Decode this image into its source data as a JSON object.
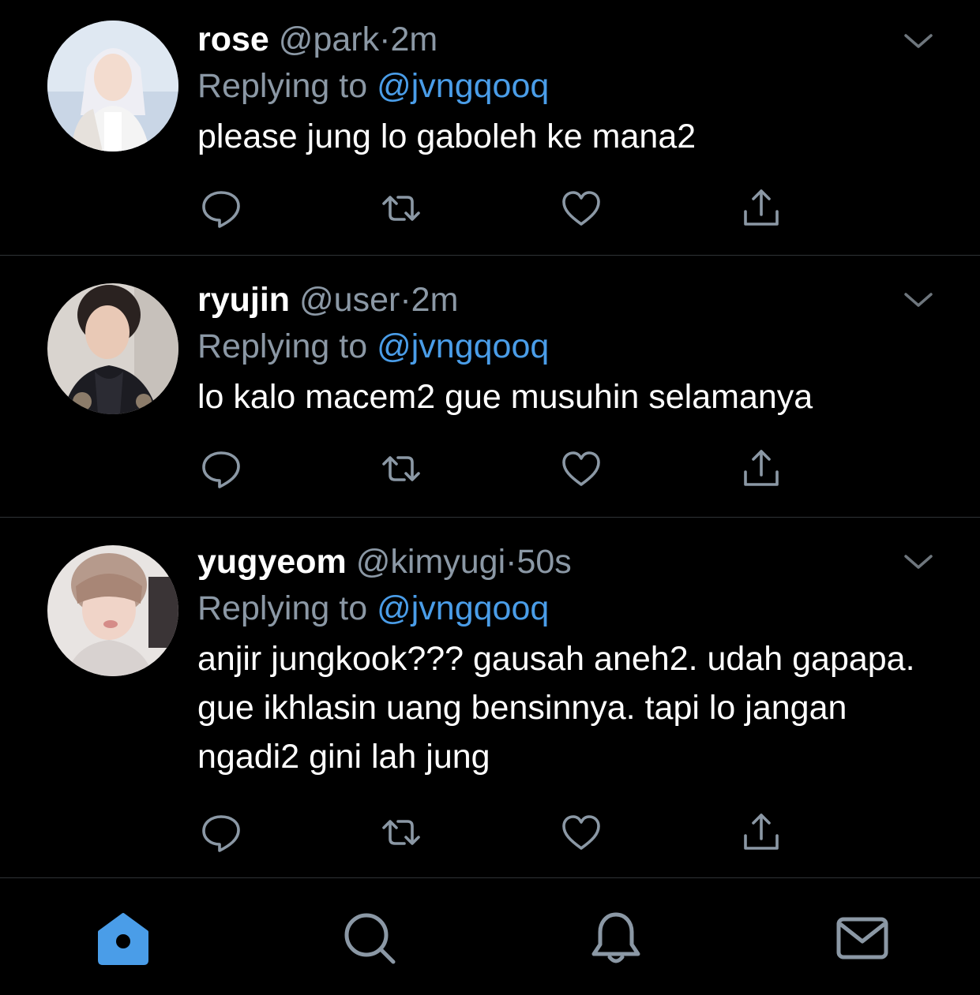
{
  "feed": {
    "tweets": [
      {
        "name": "rose",
        "handle": "@park",
        "separator": "·",
        "time": "2m",
        "replying_label": "Replying to",
        "replying_to": "@jvngqooq",
        "text": "please jung lo gaboleh ke mana2"
      },
      {
        "name": "ryujin",
        "handle": "@user",
        "separator": "·",
        "time": "2m",
        "replying_label": "Replying to",
        "replying_to": "@jvngqooq",
        "text": "lo kalo macem2 gue musuhin selamanya"
      },
      {
        "name": "yugyeom",
        "handle": "@kimyugi",
        "separator": "·",
        "time": "50s",
        "replying_label": "Replying to",
        "replying_to": "@jvngqooq",
        "text": "anjir jungkook??? gausah aneh2. udah gapapa. gue ikhlasin uang bensinnya. tapi lo jangan ngadi2 gini lah jung"
      }
    ],
    "action_icons": [
      "reply-icon",
      "retweet-icon",
      "like-icon",
      "share-icon"
    ]
  },
  "tabbar": {
    "items": [
      "home-icon",
      "search-icon",
      "notifications-icon",
      "messages-icon"
    ],
    "active": "home-icon"
  },
  "colors": {
    "background": "#000000",
    "text": "#ffffff",
    "muted": "#8b98a5",
    "accent": "#4a9de8",
    "divider": "#2f3336"
  }
}
